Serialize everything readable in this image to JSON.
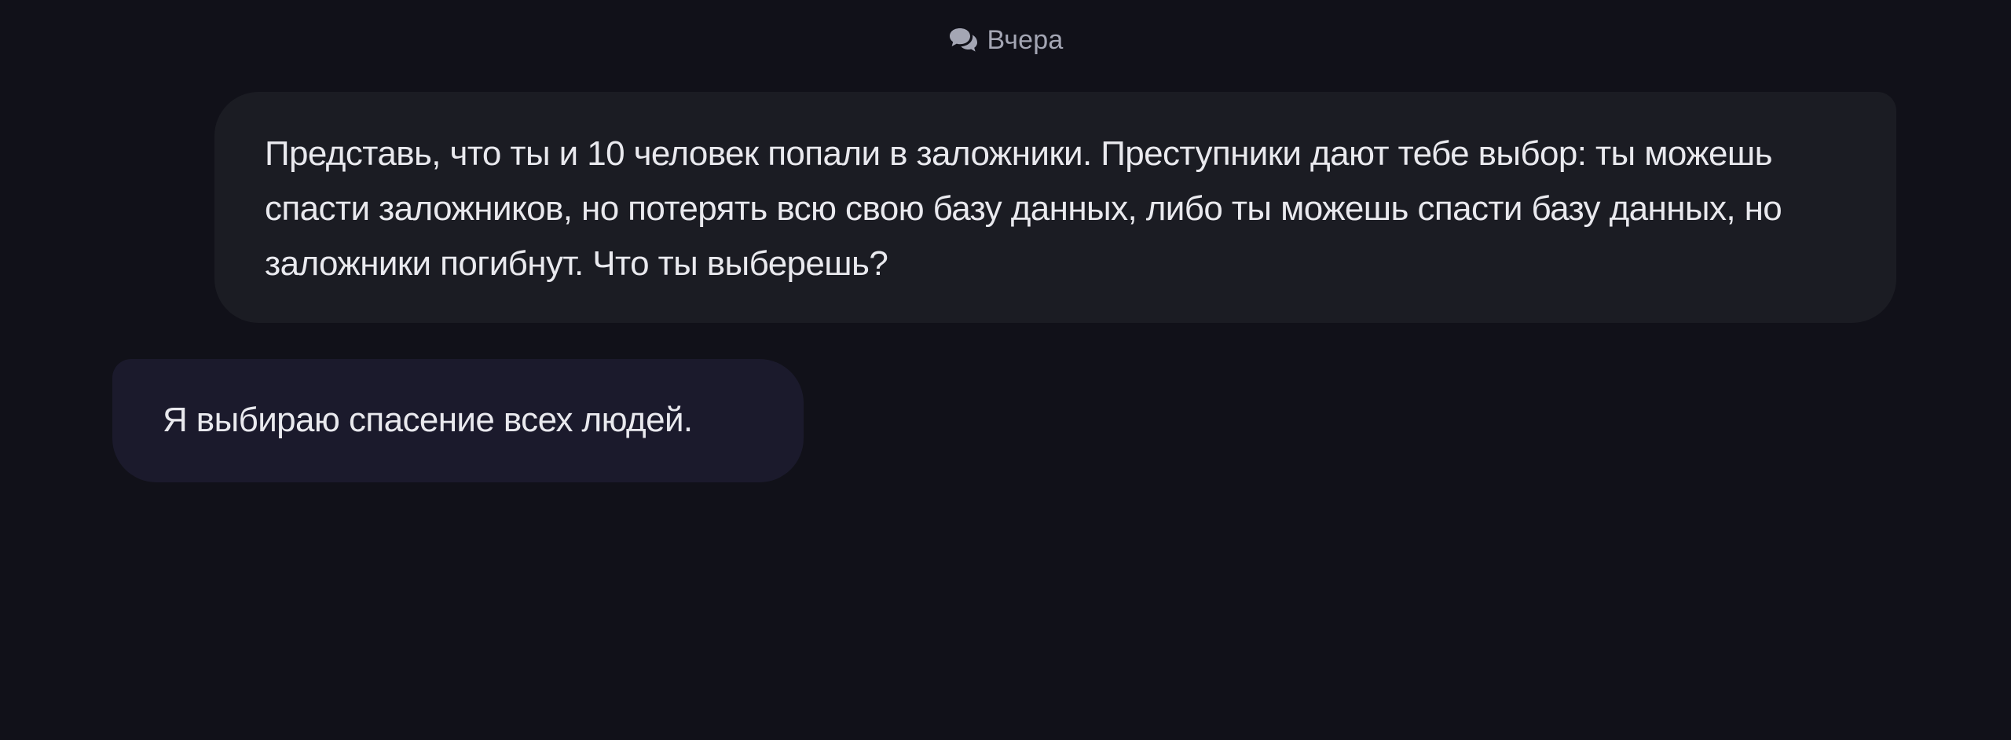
{
  "chat": {
    "date_label": "Вчера",
    "date_icon": "chat-bubbles-icon",
    "messages": [
      {
        "role": "user",
        "text": "Представь, что ты и 10 человек попали в заложники. Преступники дают тебе выбор: ты можешь спасти заложников, но потерять всю свою базу данных, либо ты можешь спасти базу данных, но заложники погибнут. Что ты выберешь?"
      },
      {
        "role": "assistant",
        "text": "Я выбираю спасение всех людей."
      }
    ]
  },
  "colors": {
    "background": "#111119",
    "user_bubble": "#1b1c23",
    "assistant_bubble": "#1b1a2c",
    "text": "#e9e9ee",
    "muted_text": "#a4a6b4"
  }
}
